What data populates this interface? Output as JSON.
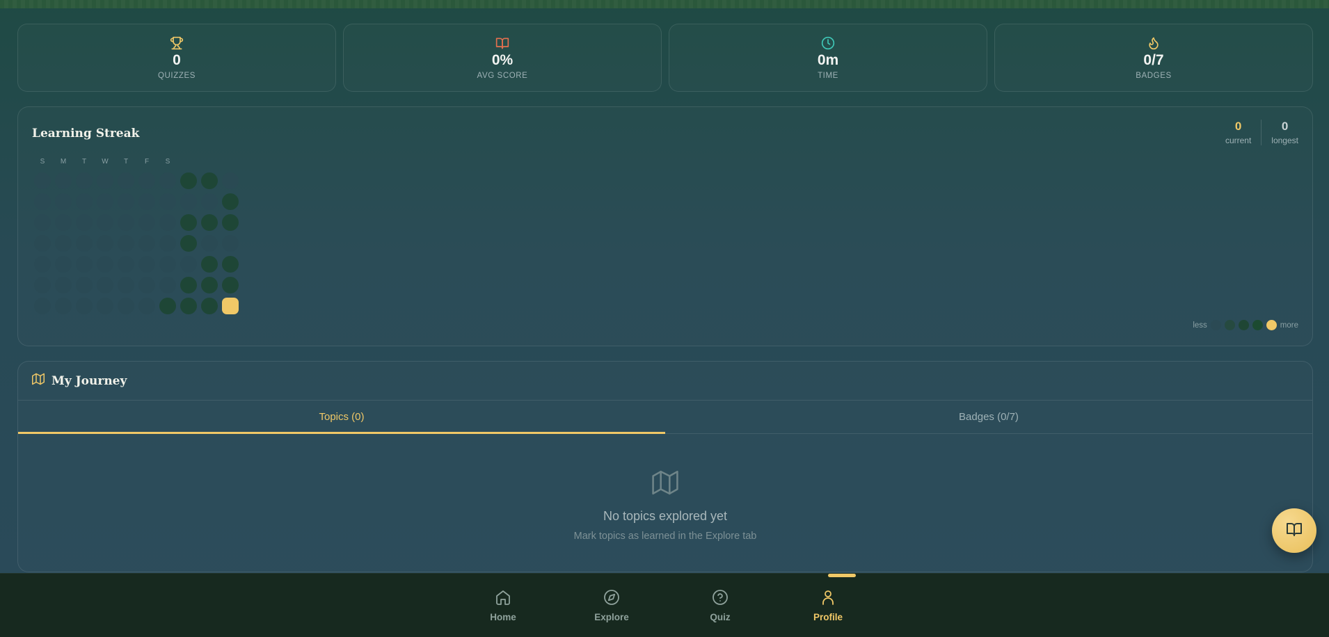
{
  "stats": [
    {
      "icon": "trophy-icon",
      "value": "0",
      "label": "QUIZZES",
      "color": "#f0c867"
    },
    {
      "icon": "book-icon",
      "value": "0%",
      "label": "AVG SCORE",
      "color": "#e4704f"
    },
    {
      "icon": "clock-icon",
      "value": "0m",
      "label": "TIME",
      "color": "#3fc6b6"
    },
    {
      "icon": "flame-icon",
      "value": "0/7",
      "label": "BADGES",
      "color": "#f0c867"
    }
  ],
  "streak": {
    "title": "Learning Streak",
    "current_value": "0",
    "current_label": "current",
    "longest_value": "0",
    "longest_label": "longest",
    "day_labels": [
      "S",
      "M",
      "T",
      "W",
      "T",
      "F",
      "S"
    ],
    "grid_levels": [
      [
        0,
        0,
        0,
        0,
        0,
        0,
        0,
        2,
        2,
        0
      ],
      [
        0,
        0,
        0,
        0,
        0,
        0,
        0,
        0,
        0,
        2
      ],
      [
        0,
        0,
        0,
        0,
        0,
        0,
        0,
        2,
        2,
        2
      ],
      [
        0,
        0,
        0,
        0,
        0,
        0,
        0,
        2,
        0,
        0
      ],
      [
        0,
        0,
        0,
        0,
        0,
        0,
        0,
        0,
        2,
        2
      ],
      [
        0,
        0,
        0,
        0,
        0,
        0,
        0,
        2,
        2,
        2
      ],
      [
        0,
        0,
        0,
        0,
        0,
        0,
        2,
        2,
        2,
        3
      ]
    ],
    "legend_less": "less",
    "legend_more": "more",
    "level_colors": [
      "#2b4a54",
      "#264a40",
      "#1f4634",
      "#1c4a30",
      "#f0c867"
    ]
  },
  "journey": {
    "title": "My Journey",
    "tabs": [
      {
        "label": "Topics (0)",
        "active": true
      },
      {
        "label": "Badges (0/7)",
        "active": false
      }
    ],
    "empty_title": "No topics explored yet",
    "empty_subtitle": "Mark topics as learned in the Explore tab"
  },
  "fab_icon": "book-icon",
  "nav": [
    {
      "label": "Home",
      "icon": "home-icon",
      "active": false
    },
    {
      "label": "Explore",
      "icon": "compass-icon",
      "active": false
    },
    {
      "label": "Quiz",
      "icon": "help-circle-icon",
      "active": false
    },
    {
      "label": "Profile",
      "icon": "user-icon",
      "active": true
    }
  ],
  "colors": {
    "accent": "#f0c867",
    "nav_bg": "#17291f"
  }
}
